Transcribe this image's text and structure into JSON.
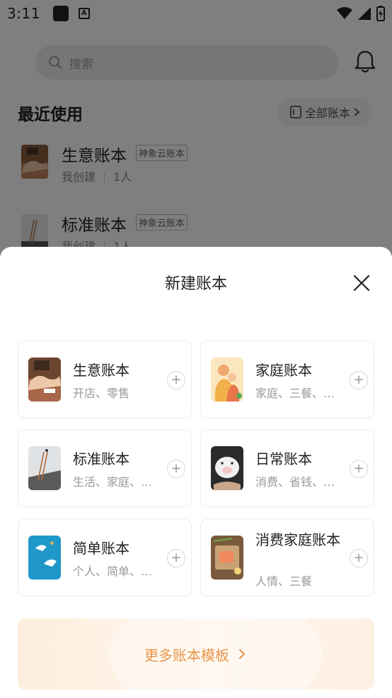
{
  "status_bar": {
    "time": "3:11"
  },
  "search": {
    "placeholder": "搜索"
  },
  "recent": {
    "title": "最近使用",
    "all_books_label": "全部账本",
    "items": [
      {
        "name": "生意账本",
        "tag": "神象云账本",
        "creator": "我创建",
        "members": "1人"
      },
      {
        "name": "标准账本",
        "tag": "神象云账本",
        "creator": "我创建",
        "members": "1人"
      }
    ]
  },
  "sheet": {
    "title": "新建账本",
    "templates": [
      {
        "name": "生意账本",
        "desc": "开店、零售"
      },
      {
        "name": "家庭账本",
        "desc": "家庭、三餐、…"
      },
      {
        "name": "标准账本",
        "desc": "生活、家庭、…"
      },
      {
        "name": "日常账本",
        "desc": "消费、省钱、…"
      },
      {
        "name": "简单账本",
        "desc": "个人、简单、…"
      },
      {
        "name": "消费家庭账本",
        "desc": "人情、三餐"
      }
    ],
    "more_label": "更多账本模板"
  }
}
